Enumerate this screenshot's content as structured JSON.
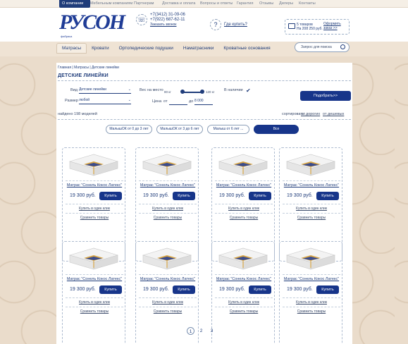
{
  "topnav": [
    "О компании",
    "Мебельным компаниям",
    "Партнерам",
    "Доставка и оплата",
    "Вопросы и ответы",
    "Гарантия",
    "Отзывы",
    "Дилеры",
    "Контакты"
  ],
  "logo": {
    "text": "РУСОН",
    "sub": "фабрика"
  },
  "contacts": {
    "phone1": "+7(3412) 31-09-06",
    "phone2": "+7(922) 687-62-11",
    "callback": "Заказать звонок"
  },
  "howbuy": "Где купить?",
  "cart": {
    "count": "5 товаров",
    "sum": "На 208 250 руб.",
    "order": "Оформить заказ >>"
  },
  "categories": [
    "Матрасы",
    "Кровати",
    "Ортопедические подушки",
    "Наматрасники",
    "Кроватные основания"
  ],
  "search": {
    "placeholder": "Запрос для поиска"
  },
  "breadcrumb": "Главная | Матрасы | Детские линейки",
  "page_title": "ДЕТСКИЕ ЛИНЕЙКИ",
  "filters": {
    "view_label": "Вид",
    "view_value": "Детские линейки",
    "size_label": "Размер",
    "size_value": "любой",
    "weight_label": "Вес на место",
    "weight_from": "80 кг",
    "weight_to": "120 кг",
    "price_label": "Цена",
    "price_from_label": "от",
    "price_to_label": "до",
    "price_to": "8 000",
    "instock_label": "В наличии",
    "pick_button": "Подобрать>>"
  },
  "results": {
    "found": "найдено 198 моделей",
    "sort_label": "сортировать:",
    "sort_opt1": "от дорогих",
    "sort_opt2": "от дешевых"
  },
  "age_filters": [
    "МалышОК от 0 до 3 лет",
    "МалышОК от 3 до 6 лет",
    "Малыш от 6 лет ...",
    "Все"
  ],
  "product": {
    "title": "Матрас \"Сонель Кокос Латекс\"",
    "price": "19 300 руб.",
    "buy": "Купить",
    "oneclick": "Купить в один клик",
    "compare": "Сравнить товары"
  },
  "pagination": [
    "1",
    "2",
    "3"
  ],
  "colors": {
    "accent": "#17358a",
    "text": "#1f3c7a",
    "bg": "#eadccb"
  }
}
